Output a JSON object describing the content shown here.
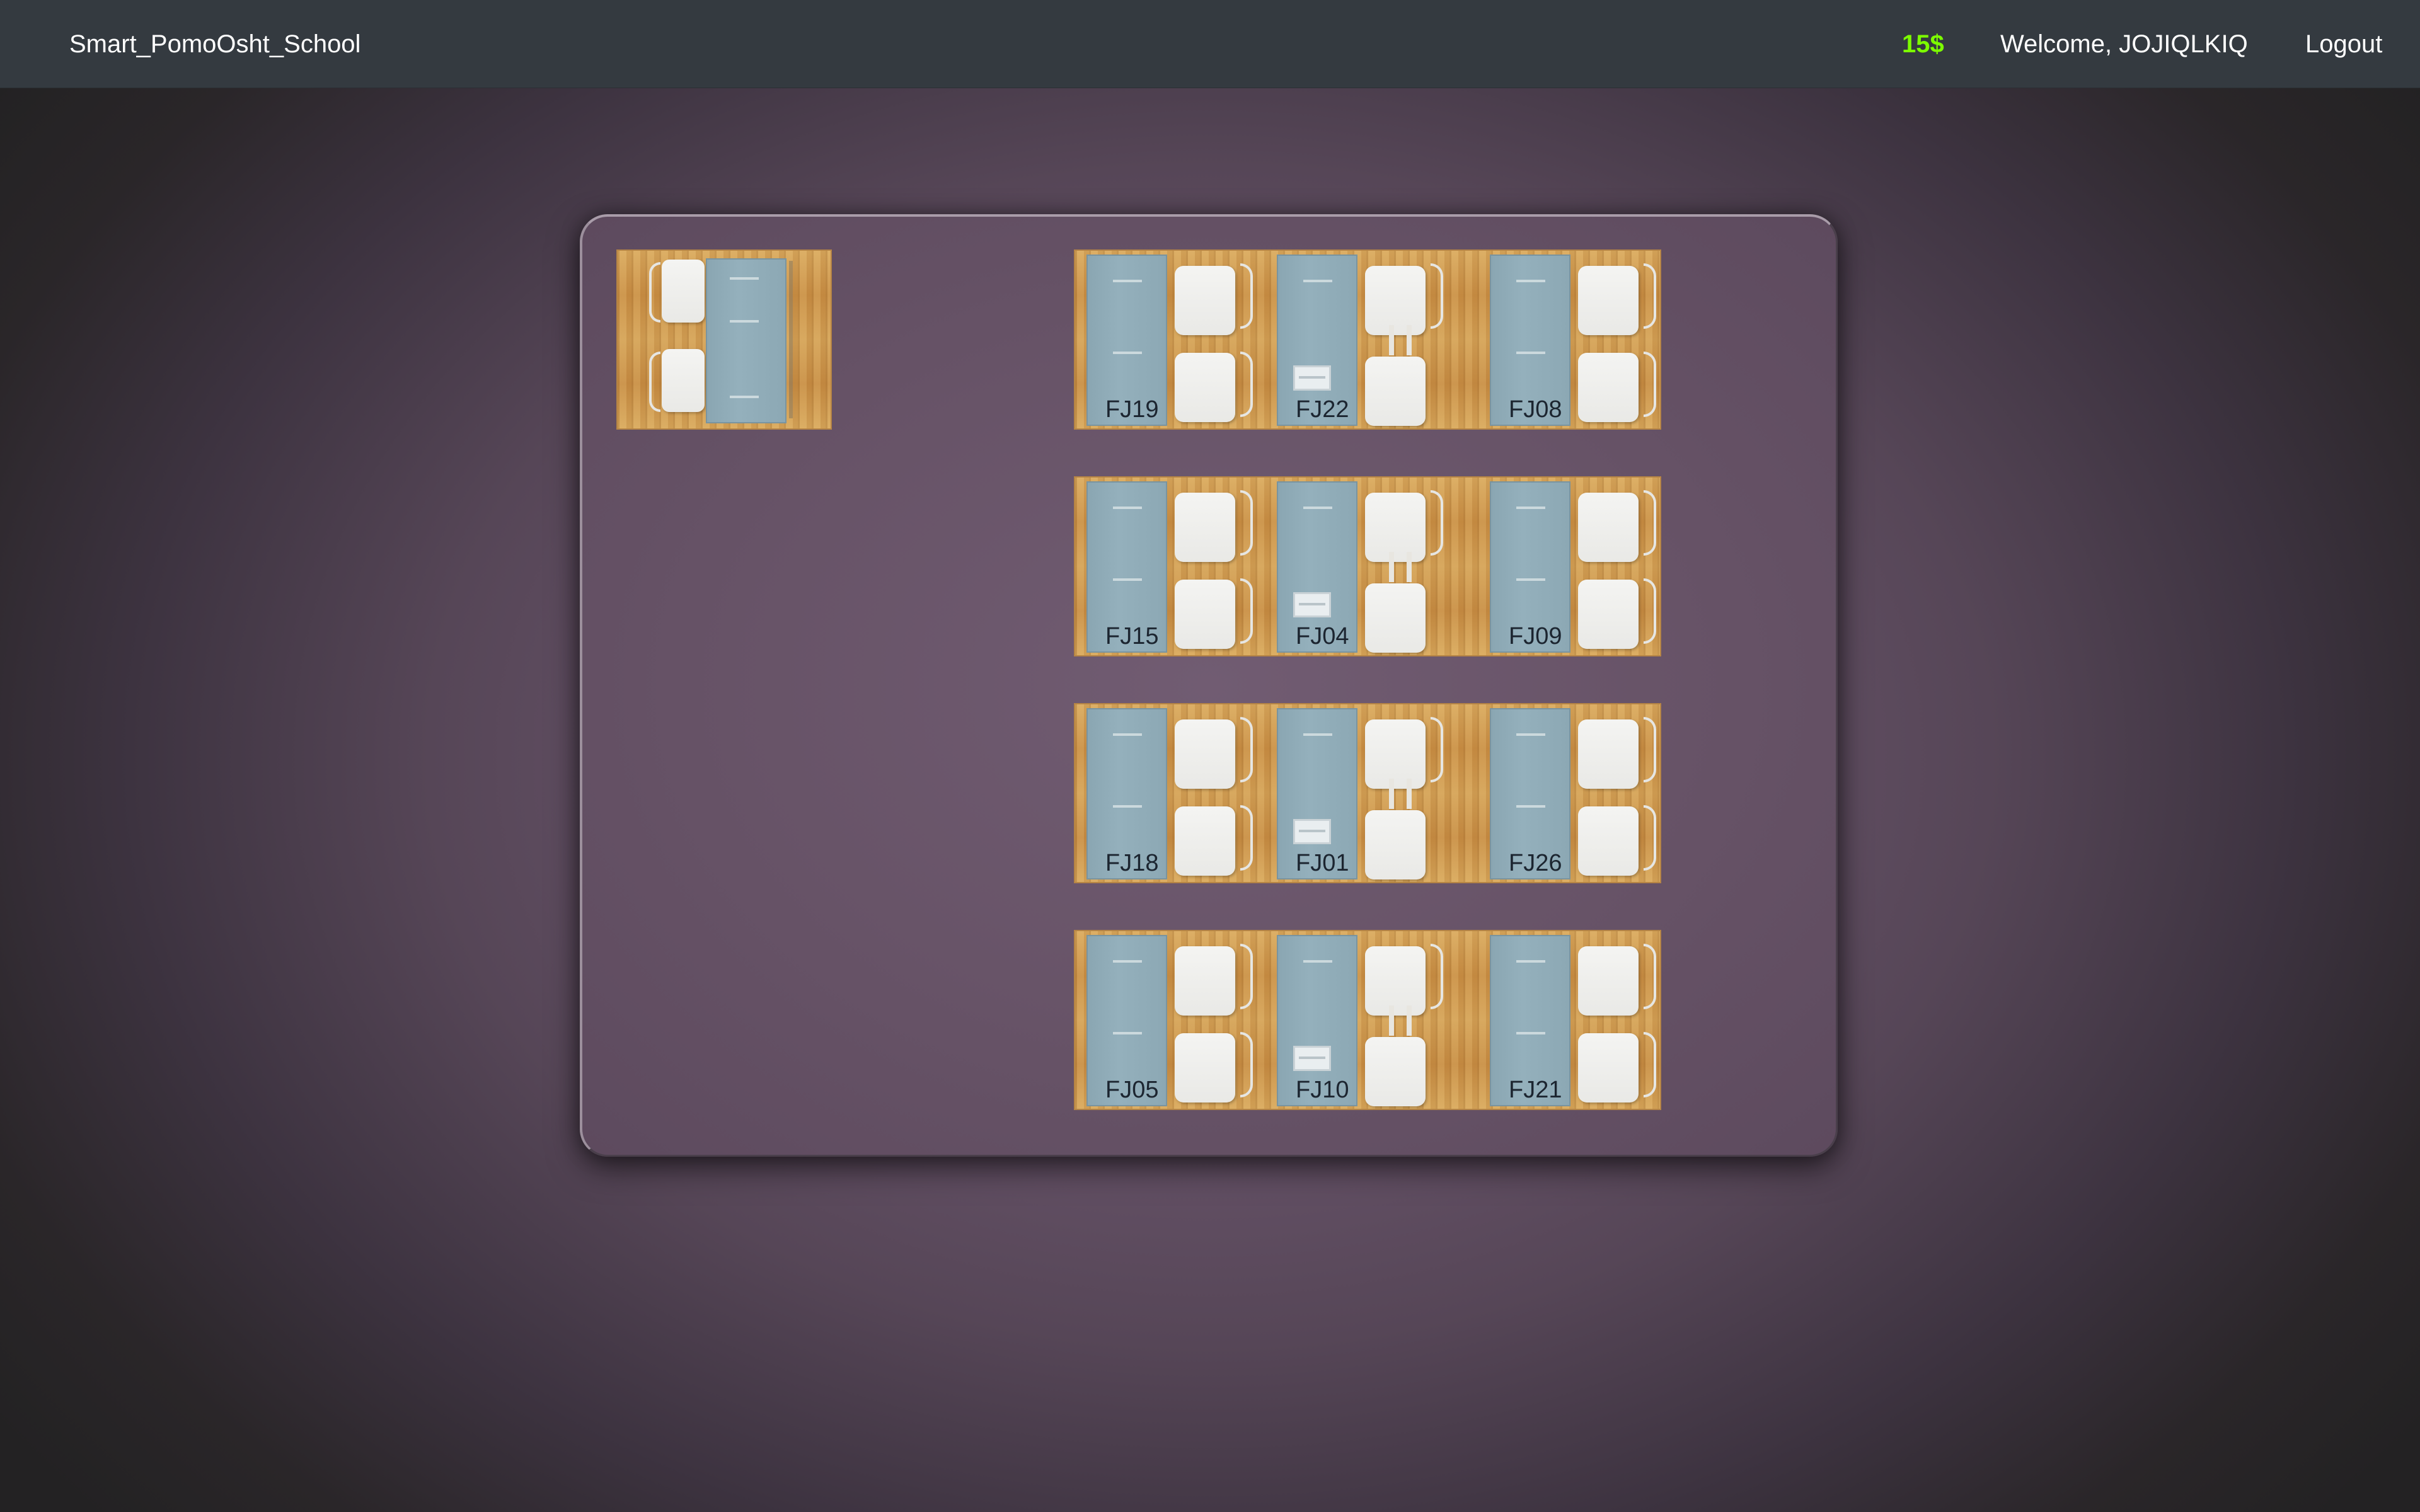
{
  "navbar": {
    "brand": "Smart_PomoOsht_School",
    "balance": "15$",
    "welcome": "Welcome, JOJIQLKIQ",
    "logout": "Logout"
  },
  "colors": {
    "navbar_bg": "#343a40",
    "balance_color": "#7cfc00",
    "room_bg": "#6b566d",
    "desk_top": "#8aa6b2"
  },
  "classroom": {
    "teacher_desk": {
      "icon": "teacher-desk-icon"
    },
    "rows": [
      {
        "seats": [
          {
            "id": "FJ19",
            "tablet": false
          },
          {
            "id": "FJ22",
            "tablet": true
          },
          {
            "id": "FJ08",
            "tablet": false
          }
        ]
      },
      {
        "seats": [
          {
            "id": "FJ15",
            "tablet": false
          },
          {
            "id": "FJ04",
            "tablet": true
          },
          {
            "id": "FJ09",
            "tablet": false
          }
        ]
      },
      {
        "seats": [
          {
            "id": "FJ18",
            "tablet": false
          },
          {
            "id": "FJ01",
            "tablet": true
          },
          {
            "id": "FJ26",
            "tablet": false
          }
        ]
      },
      {
        "seats": [
          {
            "id": "FJ05",
            "tablet": false
          },
          {
            "id": "FJ10",
            "tablet": true
          },
          {
            "id": "FJ21",
            "tablet": false
          }
        ]
      }
    ]
  }
}
